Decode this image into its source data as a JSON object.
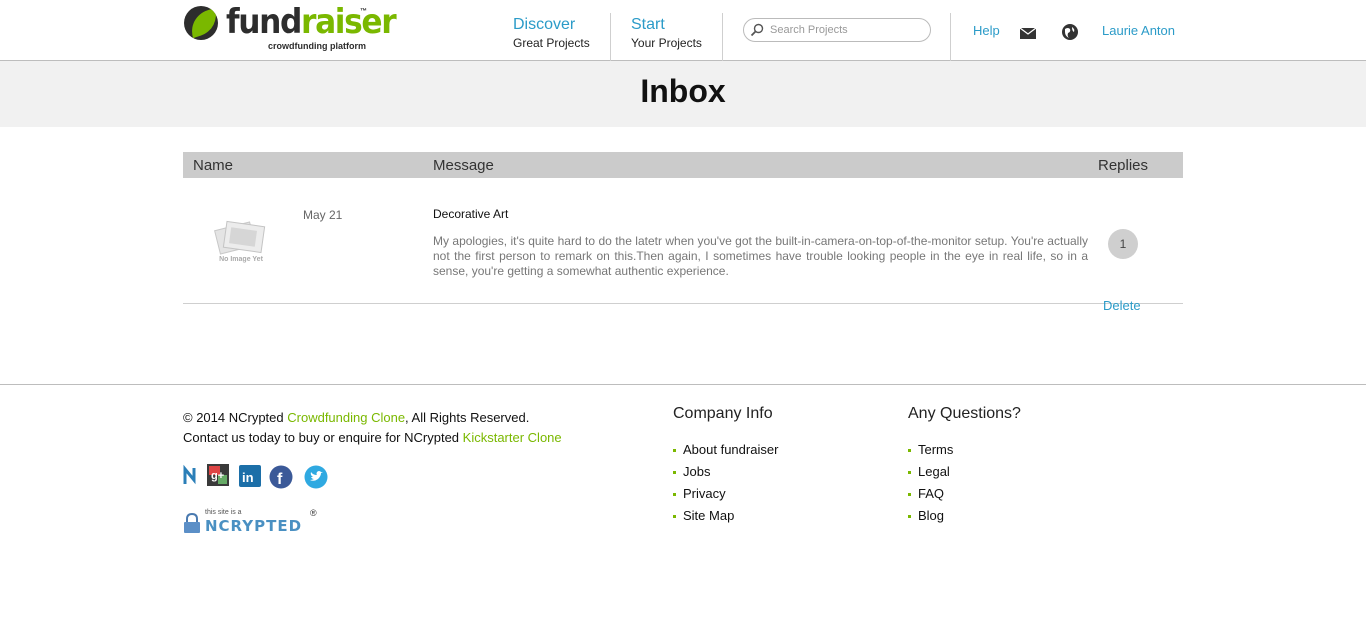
{
  "header": {
    "logo_text_1": "fund",
    "logo_text_2": "raiser",
    "logo_tm": "™",
    "logo_tagline": "crowdfunding platform",
    "nav": [
      {
        "big": "Discover",
        "small": "Great Projects"
      },
      {
        "big": "Start",
        "small": "Your Projects"
      }
    ],
    "search_placeholder": "Search Projects",
    "help_label": "Help",
    "user_name": "Laurie Anton"
  },
  "page": {
    "title": "Inbox"
  },
  "inbox": {
    "columns": {
      "name": "Name",
      "message": "Message",
      "replies": "Replies"
    },
    "rows": [
      {
        "thumb_label": "No Image Yet",
        "date": "May 21",
        "subject": "Decorative Art",
        "message": "My apologies, it's quite hard to do the latetr when you've got the built-in-camera-on-top-of-the-monitor setup. You're actually not the first person to remark on this.Then again, I sometimes have trouble looking people in the eye in real life, so in a sense, you're getting a somewhat authentic experience.",
        "replies": "1",
        "delete_label": "Delete"
      }
    ]
  },
  "footer": {
    "copyright_pre": "© 2014 NCrypted ",
    "copyright_link": "Crowdfunding Clone",
    "copyright_post": ", All Rights Reserved.",
    "contact_pre": "Contact us today to buy or enquire for NCrypted ",
    "contact_link": "Kickstarter Clone",
    "ncrypted_small": "this site is a",
    "ncrypted_big": "NCRYPTED",
    "ncrypted_reg": "®",
    "company_title": "Company Info",
    "company_links": [
      "About fundraiser",
      "Jobs",
      "Privacy",
      "Site Map"
    ],
    "questions_title": "Any Questions?",
    "questions_links": [
      "Terms",
      "Legal",
      "FAQ",
      "Blog"
    ],
    "social_icons": [
      "ncrypted-icon",
      "google-plus-icon",
      "linkedin-icon",
      "facebook-icon",
      "twitter-icon"
    ]
  },
  "colors": {
    "accent_blue": "#2b9bc8",
    "brand_green": "#7ab800"
  }
}
